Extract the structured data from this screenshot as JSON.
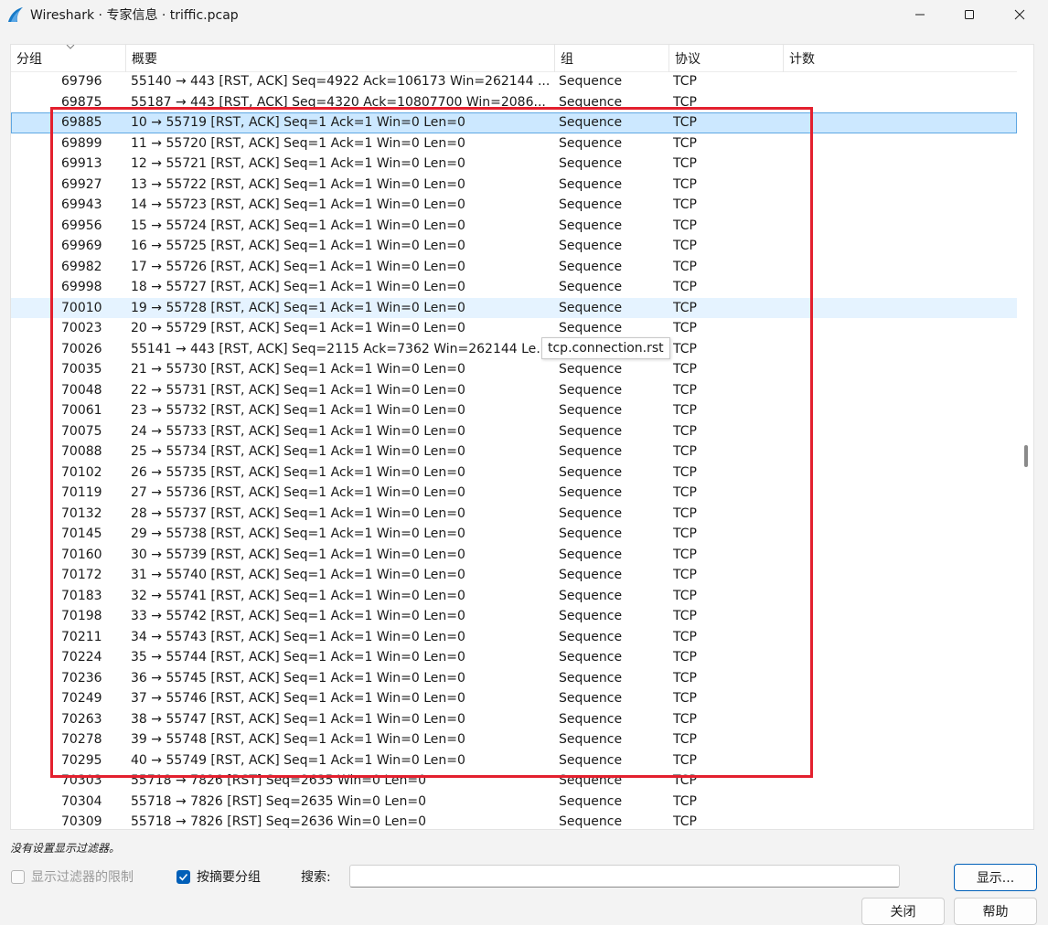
{
  "window": {
    "title": "Wireshark · 专家信息 · triffic.pcap"
  },
  "table": {
    "columns": [
      "分组",
      "概要",
      "组",
      "协议",
      "计数"
    ],
    "rows": [
      {
        "num": "69796",
        "summary": "55140 → 443 [RST, ACK] Seq=4922 Ack=106173 Win=262144 ...",
        "group": "Sequence",
        "protocol": "TCP"
      },
      {
        "num": "69875",
        "summary": "55187 → 443 [RST, ACK] Seq=4320 Ack=10807700 Win=2086...",
        "group": "Sequence",
        "protocol": "TCP"
      },
      {
        "num": "69885",
        "summary": "10 → 55719 [RST, ACK] Seq=1 Ack=1 Win=0 Len=0",
        "group": "Sequence",
        "protocol": "TCP",
        "state": "selected"
      },
      {
        "num": "69899",
        "summary": "11 → 55720 [RST, ACK] Seq=1 Ack=1 Win=0 Len=0",
        "group": "Sequence",
        "protocol": "TCP"
      },
      {
        "num": "69913",
        "summary": "12 → 55721 [RST, ACK] Seq=1 Ack=1 Win=0 Len=0",
        "group": "Sequence",
        "protocol": "TCP"
      },
      {
        "num": "69927",
        "summary": "13 → 55722 [RST, ACK] Seq=1 Ack=1 Win=0 Len=0",
        "group": "Sequence",
        "protocol": "TCP"
      },
      {
        "num": "69943",
        "summary": "14 → 55723 [RST, ACK] Seq=1 Ack=1 Win=0 Len=0",
        "group": "Sequence",
        "protocol": "TCP"
      },
      {
        "num": "69956",
        "summary": "15 → 55724 [RST, ACK] Seq=1 Ack=1 Win=0 Len=0",
        "group": "Sequence",
        "protocol": "TCP"
      },
      {
        "num": "69969",
        "summary": "16 → 55725 [RST, ACK] Seq=1 Ack=1 Win=0 Len=0",
        "group": "Sequence",
        "protocol": "TCP"
      },
      {
        "num": "69982",
        "summary": "17 → 55726 [RST, ACK] Seq=1 Ack=1 Win=0 Len=0",
        "group": "Sequence",
        "protocol": "TCP"
      },
      {
        "num": "69998",
        "summary": "18 → 55727 [RST, ACK] Seq=1 Ack=1 Win=0 Len=0",
        "group": "Sequence",
        "protocol": "TCP"
      },
      {
        "num": "70010",
        "summary": "19 → 55728 [RST, ACK] Seq=1 Ack=1 Win=0 Len=0",
        "group": "Sequence",
        "protocol": "TCP",
        "state": "hover"
      },
      {
        "num": "70023",
        "summary": "20 → 55729 [RST, ACK] Seq=1 Ack=1 Win=0 Len=0",
        "group": "Sequence",
        "protocol": "TCP"
      },
      {
        "num": "70026",
        "summary": "55141 → 443 [RST, ACK] Seq=2115 Ack=7362 Win=262144 Len=0",
        "group": "Sequence",
        "protocol": "TCP"
      },
      {
        "num": "70035",
        "summary": "21 → 55730 [RST, ACK] Seq=1 Ack=1 Win=0 Len=0",
        "group": "Sequence",
        "protocol": "TCP"
      },
      {
        "num": "70048",
        "summary": "22 → 55731 [RST, ACK] Seq=1 Ack=1 Win=0 Len=0",
        "group": "Sequence",
        "protocol": "TCP"
      },
      {
        "num": "70061",
        "summary": "23 → 55732 [RST, ACK] Seq=1 Ack=1 Win=0 Len=0",
        "group": "Sequence",
        "protocol": "TCP"
      },
      {
        "num": "70075",
        "summary": "24 → 55733 [RST, ACK] Seq=1 Ack=1 Win=0 Len=0",
        "group": "Sequence",
        "protocol": "TCP"
      },
      {
        "num": "70088",
        "summary": "25 → 55734 [RST, ACK] Seq=1 Ack=1 Win=0 Len=0",
        "group": "Sequence",
        "protocol": "TCP"
      },
      {
        "num": "70102",
        "summary": "26 → 55735 [RST, ACK] Seq=1 Ack=1 Win=0 Len=0",
        "group": "Sequence",
        "protocol": "TCP"
      },
      {
        "num": "70119",
        "summary": "27 → 55736 [RST, ACK] Seq=1 Ack=1 Win=0 Len=0",
        "group": "Sequence",
        "protocol": "TCP"
      },
      {
        "num": "70132",
        "summary": "28 → 55737 [RST, ACK] Seq=1 Ack=1 Win=0 Len=0",
        "group": "Sequence",
        "protocol": "TCP"
      },
      {
        "num": "70145",
        "summary": "29 → 55738 [RST, ACK] Seq=1 Ack=1 Win=0 Len=0",
        "group": "Sequence",
        "protocol": "TCP"
      },
      {
        "num": "70160",
        "summary": "30 → 55739 [RST, ACK] Seq=1 Ack=1 Win=0 Len=0",
        "group": "Sequence",
        "protocol": "TCP"
      },
      {
        "num": "70172",
        "summary": "31 → 55740 [RST, ACK] Seq=1 Ack=1 Win=0 Len=0",
        "group": "Sequence",
        "protocol": "TCP"
      },
      {
        "num": "70183",
        "summary": "32 → 55741 [RST, ACK] Seq=1 Ack=1 Win=0 Len=0",
        "group": "Sequence",
        "protocol": "TCP"
      },
      {
        "num": "70198",
        "summary": "33 → 55742 [RST, ACK] Seq=1 Ack=1 Win=0 Len=0",
        "group": "Sequence",
        "protocol": "TCP"
      },
      {
        "num": "70211",
        "summary": "34 → 55743 [RST, ACK] Seq=1 Ack=1 Win=0 Len=0",
        "group": "Sequence",
        "protocol": "TCP"
      },
      {
        "num": "70224",
        "summary": "35 → 55744 [RST, ACK] Seq=1 Ack=1 Win=0 Len=0",
        "group": "Sequence",
        "protocol": "TCP"
      },
      {
        "num": "70236",
        "summary": "36 → 55745 [RST, ACK] Seq=1 Ack=1 Win=0 Len=0",
        "group": "Sequence",
        "protocol": "TCP"
      },
      {
        "num": "70249",
        "summary": "37 → 55746 [RST, ACK] Seq=1 Ack=1 Win=0 Len=0",
        "group": "Sequence",
        "protocol": "TCP"
      },
      {
        "num": "70263",
        "summary": "38 → 55747 [RST, ACK] Seq=1 Ack=1 Win=0 Len=0",
        "group": "Sequence",
        "protocol": "TCP"
      },
      {
        "num": "70278",
        "summary": "39 → 55748 [RST, ACK] Seq=1 Ack=1 Win=0 Len=0",
        "group": "Sequence",
        "protocol": "TCP"
      },
      {
        "num": "70295",
        "summary": "40 → 55749 [RST, ACK] Seq=1 Ack=1 Win=0 Len=0",
        "group": "Sequence",
        "protocol": "TCP"
      },
      {
        "num": "70303",
        "summary": "55718 → 7826 [RST] Seq=2635 Win=0 Len=0",
        "group": "Sequence",
        "protocol": "TCP"
      },
      {
        "num": "70304",
        "summary": "55718 → 7826 [RST] Seq=2635 Win=0 Len=0",
        "group": "Sequence",
        "protocol": "TCP"
      },
      {
        "num": "70309",
        "summary": "55718 → 7826 [RST] Seq=2636 Win=0 Len=0",
        "group": "Sequence",
        "protocol": "TCP"
      }
    ]
  },
  "tooltip": "tcp.connection.rst",
  "status": "没有设置显示过滤器。",
  "options": {
    "limit_to_filter": "显示过滤器的限制",
    "limit_to_filter_checked": false,
    "group_by_summary": "按摘要分组",
    "group_by_summary_checked": true
  },
  "search": {
    "label": "搜索:",
    "value": ""
  },
  "buttons": {
    "show": "显示...",
    "close": "关闭",
    "help": "帮助"
  },
  "colors": {
    "selection": "#cce8ff",
    "hover": "#e5f3ff",
    "annotation": "#e3202e",
    "accent": "#005fb8"
  }
}
